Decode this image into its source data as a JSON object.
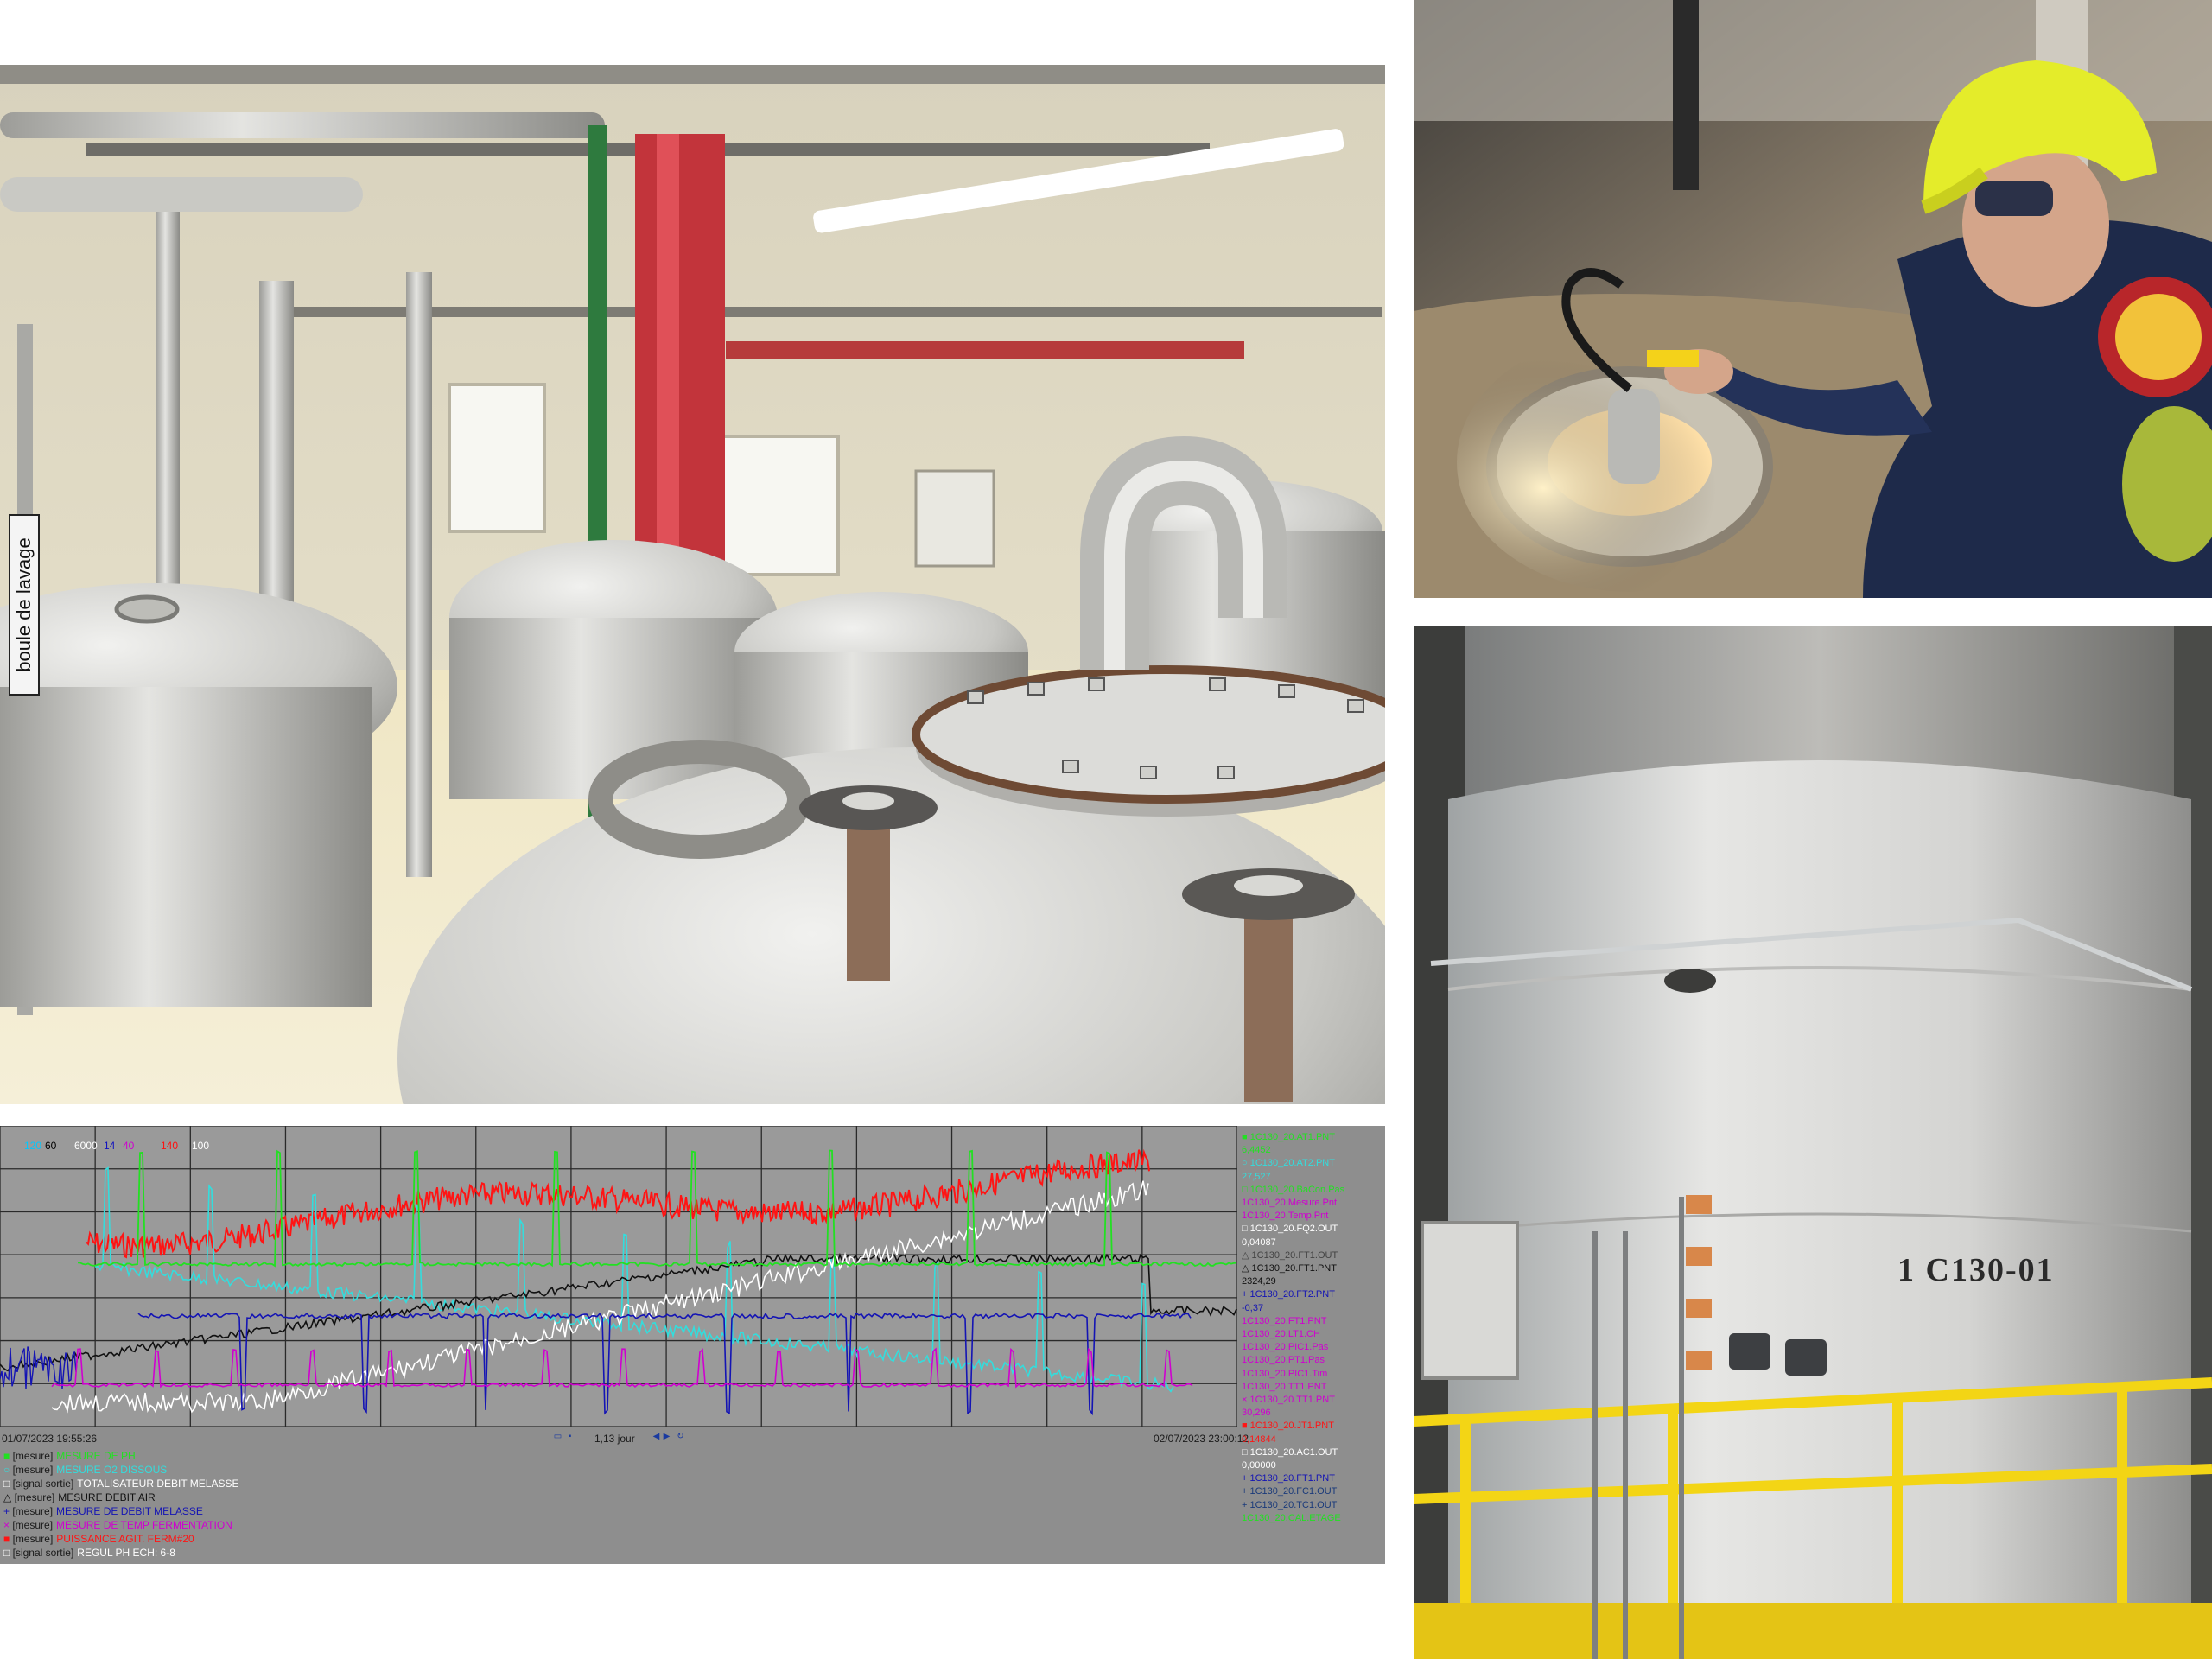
{
  "plant_photo": {
    "sign_text": "boule de lavage"
  },
  "tank_photo": {
    "tank_id": "1 C130-01"
  },
  "trend": {
    "scale_labels": [
      {
        "text": "120",
        "color": "#00c8ff"
      },
      {
        "text": "60",
        "color": "#000000"
      },
      {
        "text": "6000",
        "color": "#ffffff"
      },
      {
        "text": "14",
        "color": "#1010c0"
      },
      {
        "text": "40",
        "color": "#d000d0"
      },
      {
        "text": "140",
        "color": "#ff1010"
      },
      {
        "text": "100",
        "color": "#ffffff"
      }
    ],
    "start_time": "01/07/2023 19:55:26",
    "end_time": "02/07/2023 23:00:12",
    "timespan": "1,13 jour",
    "legend": [
      {
        "marker": "■",
        "tag": "[mesure]",
        "name": "MESURE DE PH",
        "color": "#22e022"
      },
      {
        "marker": "○",
        "tag": "[mesure]",
        "name": "MESURE O2 DISSOUS",
        "color": "#33dddd"
      },
      {
        "marker": "□",
        "tag": "[signal sortie]",
        "name": "TOTALISATEUR DEBIT MELASSE",
        "color": "#ffffff"
      },
      {
        "marker": "△",
        "tag": "[mesure]",
        "name": "MESURE DEBIT AIR",
        "color": "#111111"
      },
      {
        "marker": "+",
        "tag": "[mesure]",
        "name": "MESURE DE DEBIT   MELASSE",
        "color": "#1414b4"
      },
      {
        "marker": "×",
        "tag": "[mesure]",
        "name": "MESURE DE TEMP  FERMENTATION",
        "color": "#d000d0"
      },
      {
        "marker": "■",
        "tag": "[mesure]",
        "name": "PUISSANCE AGIT.   FERM#20",
        "color": "#ff1414"
      },
      {
        "marker": "□",
        "tag": "[signal sortie]",
        "name": "REGUL PH         ECH: 6-8",
        "color": "#ffffff"
      }
    ],
    "right_legend": [
      {
        "text": "■ 1C130_20.AT1.PNT",
        "color": "#22e022"
      },
      {
        "text": "   6,4452",
        "color": "#22e022"
      },
      {
        "text": "○ 1C130_20.AT2.PNT",
        "color": "#33dddd"
      },
      {
        "text": "   27,527",
        "color": "#33dddd"
      },
      {
        "text": "□ 1C130_20.BaCon.Pas",
        "color": "#22e022"
      },
      {
        "text": "   1C130_20.Mesure.Pnt",
        "color": "#d000d0"
      },
      {
        "text": "   1C130_20.Temp.Pnt",
        "color": "#d000d0"
      },
      {
        "text": "□ 1C130_20.FQ2.OUT",
        "color": "#ffffff"
      },
      {
        "text": "   0,04087",
        "color": "#ffffff"
      },
      {
        "text": "△ 1C130_20.FT1.OUT",
        "color": "#444444"
      },
      {
        "text": "△ 1C130_20.FT1.PNT",
        "color": "#111111"
      },
      {
        "text": "   2324,29",
        "color": "#111111"
      },
      {
        "text": "+ 1C130_20.FT2.PNT",
        "color": "#1414b4"
      },
      {
        "text": "   -0,37",
        "color": "#1414b4"
      },
      {
        "text": "   1C130_20.FT1.PNT",
        "color": "#d000d0"
      },
      {
        "text": "   1C130_20.LT1.CH",
        "color": "#d000d0"
      },
      {
        "text": "   1C130_20.PIC1.Pas",
        "color": "#d000d0"
      },
      {
        "text": "   1C130_20.PT1.Pas",
        "color": "#d000d0"
      },
      {
        "text": "   1C130_20.PIC1.Tim",
        "color": "#d000d0"
      },
      {
        "text": "   1C130_20.TT1.PNT",
        "color": "#d000d0"
      },
      {
        "text": "× 1C130_20.TT1.PNT",
        "color": "#d000d0"
      },
      {
        "text": "   30,296",
        "color": "#d000d0"
      },
      {
        "text": "■ 1C130_20.JT1.PNT",
        "color": "#ff1414"
      },
      {
        "text": "   0,14844",
        "color": "#ff1414"
      },
      {
        "text": "□ 1C130_20.AC1.OUT",
        "color": "#ffffff"
      },
      {
        "text": "   0,00000",
        "color": "#ffffff"
      },
      {
        "text": "+ 1C130_20.FT1.PNT",
        "color": "#1414b4"
      },
      {
        "text": "+ 1C130_20.FC1.OUT",
        "color": "#1a3a7a"
      },
      {
        "text": "+ 1C130_20.TC1.OUT",
        "color": "#1a3a7a"
      },
      {
        "text": "   1C130_20.CAL.ETAGE",
        "color": "#22e022"
      }
    ]
  },
  "colors": {
    "ph": "#22e022",
    "o2": "#33dddd",
    "melasse_total": "#ffffff",
    "air": "#111111",
    "debit_melasse": "#1414b4",
    "temp": "#d000d0",
    "puissance": "#ff1414"
  }
}
